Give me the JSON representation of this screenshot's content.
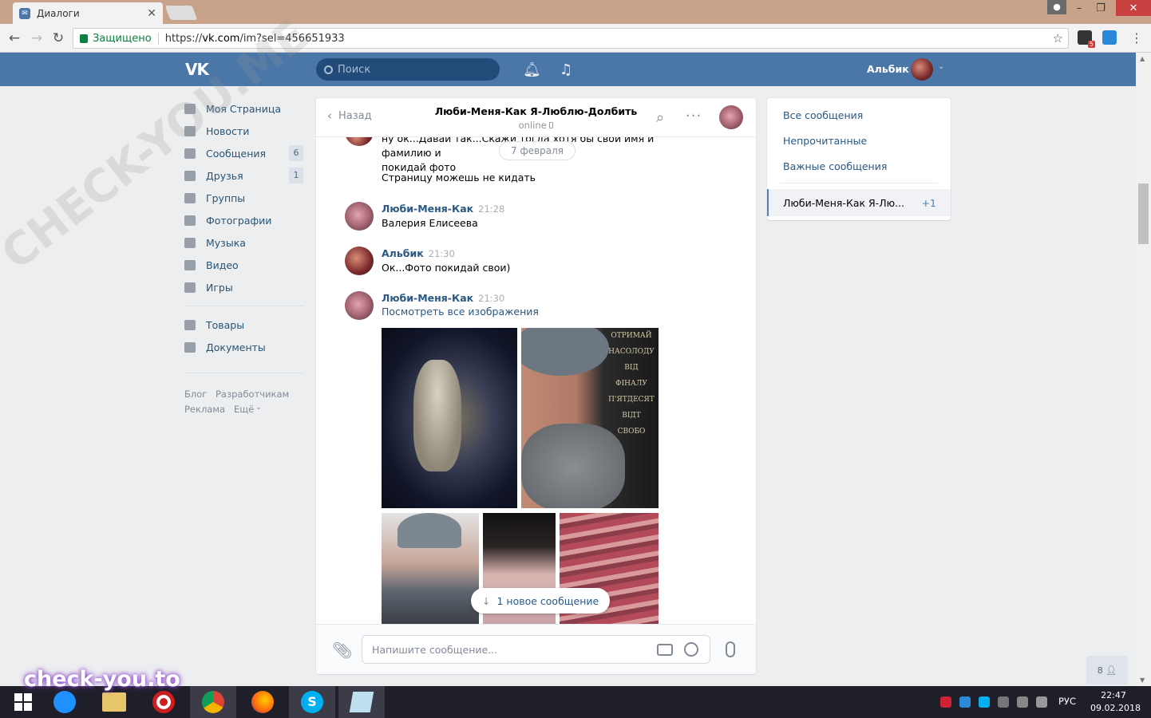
{
  "browser": {
    "tab_title": "Диалоги",
    "secure_label": "Защищено",
    "url_scheme": "https://",
    "url_host": "vk.com",
    "url_path": "/im?sel=456651933",
    "ext_badge": "5"
  },
  "vk_header": {
    "logo": "VK",
    "search_placeholder": "Поиск",
    "username": "Альбик"
  },
  "left_menu": {
    "items": [
      {
        "label": "Моя Страница",
        "icon": "home-icon"
      },
      {
        "label": "Новости",
        "icon": "news-icon"
      },
      {
        "label": "Сообщения",
        "icon": "messages-icon",
        "badge": "6"
      },
      {
        "label": "Друзья",
        "icon": "friends-icon",
        "badge": "1"
      },
      {
        "label": "Группы",
        "icon": "groups-icon"
      },
      {
        "label": "Фотографии",
        "icon": "camera-icon"
      },
      {
        "label": "Музыка",
        "icon": "music-icon"
      },
      {
        "label": "Видео",
        "icon": "video-icon"
      },
      {
        "label": "Игры",
        "icon": "games-icon"
      },
      {
        "label": "Товары",
        "icon": "bag-icon"
      },
      {
        "label": "Документы",
        "icon": "document-icon"
      }
    ],
    "footer": [
      "Блог",
      "Разработчикам",
      "Реклама",
      "Ещё"
    ]
  },
  "dialog": {
    "back_label": "Назад",
    "title": "Люби-Меня-Как Я-Люблю-Долбить",
    "status": "online",
    "date_divider": "7 февраля",
    "messages": [
      {
        "text_lines": [
          "ну ок...Давай так...Скажи тогда хотя бы свои имя и фамилию и",
          "покидай фото"
        ]
      },
      {
        "text": "Страницу можешь не кидать"
      },
      {
        "author": "Люби-Меня-Как",
        "time": "21:28",
        "text": "Валерия Елисеева"
      },
      {
        "author": "Альбик",
        "time": "21:30",
        "text": "Ок...Фото покидай свои)"
      },
      {
        "author": "Люби-Меня-Как",
        "time": "21:30",
        "link": "Посмотреть все изображения"
      }
    ],
    "poster_text": [
      "ОТРИМАЙ",
      "НАСОЛОДУ",
      "ВІД",
      "ФІНАЛУ",
      "П'ЯТДЕСЯТ ВІДТ",
      "СВОБО"
    ],
    "new_message_pill": "1 новое сообщение",
    "compose_placeholder": "Напишите сообщение..."
  },
  "right_panel": {
    "links": [
      "Все сообщения",
      "Непрочитанные",
      "Важные сообщения"
    ],
    "active_chat": "Люби-Меня-Как Я-Лю...",
    "active_count": "+1"
  },
  "friends_online": "8",
  "taskbar": {
    "lang": "РУС",
    "time": "22:47",
    "date": "09.02.2018"
  },
  "watermarks": {
    "bottom": "check-you.to",
    "diagonal": "CHECK-YOU.ME"
  },
  "colors": {
    "vk_blue": "#4a76a8",
    "link": "#2a5885",
    "background": "#edeef0"
  }
}
